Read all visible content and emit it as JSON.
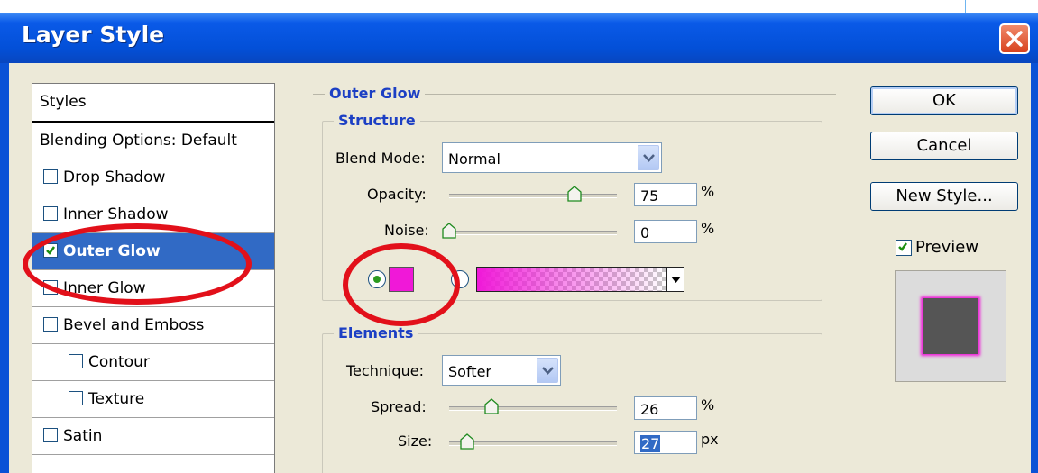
{
  "window": {
    "title": "Layer Style"
  },
  "styles_list": {
    "header": "Styles",
    "items": [
      {
        "label": "Blending Options: Default",
        "checkbox": false,
        "checked": false,
        "selected": false
      },
      {
        "label": "Drop Shadow",
        "checkbox": true,
        "checked": false,
        "selected": false
      },
      {
        "label": "Inner Shadow",
        "checkbox": true,
        "checked": false,
        "selected": false
      },
      {
        "label": "Outer Glow",
        "checkbox": true,
        "checked": true,
        "selected": true
      },
      {
        "label": "Inner Glow",
        "checkbox": true,
        "checked": false,
        "selected": false
      },
      {
        "label": "Bevel and Emboss",
        "checkbox": true,
        "checked": false,
        "selected": false
      },
      {
        "label": "Contour",
        "checkbox": true,
        "checked": false,
        "selected": false
      },
      {
        "label": "Texture",
        "checkbox": true,
        "checked": false,
        "selected": false
      },
      {
        "label": "Satin",
        "checkbox": true,
        "checked": false,
        "selected": false
      }
    ]
  },
  "outer_glow": {
    "title": "Outer Glow",
    "structure": {
      "title": "Structure",
      "blend_mode": {
        "label": "Blend Mode:",
        "value": "Normal"
      },
      "opacity": {
        "label": "Opacity:",
        "value": "75",
        "unit": "%",
        "level": 0.75
      },
      "noise": {
        "label": "Noise:",
        "value": "0",
        "unit": "%",
        "level": 0
      },
      "color_mode": "solid",
      "glow_color": "#f018d8"
    },
    "elements": {
      "title": "Elements",
      "technique": {
        "label": "Technique:",
        "value": "Softer"
      },
      "spread": {
        "label": "Spread:",
        "value": "26",
        "unit": "%",
        "level": 0.26
      },
      "size": {
        "label": "Size:",
        "value": "27",
        "unit": "px",
        "level": 0.11
      }
    }
  },
  "buttons": {
    "ok": "OK",
    "cancel": "Cancel",
    "new_style": "New Style..."
  },
  "preview": {
    "label": "Preview",
    "checked": true
  },
  "annotation_color": "#e2101a",
  "accent_color": "#316ac5"
}
